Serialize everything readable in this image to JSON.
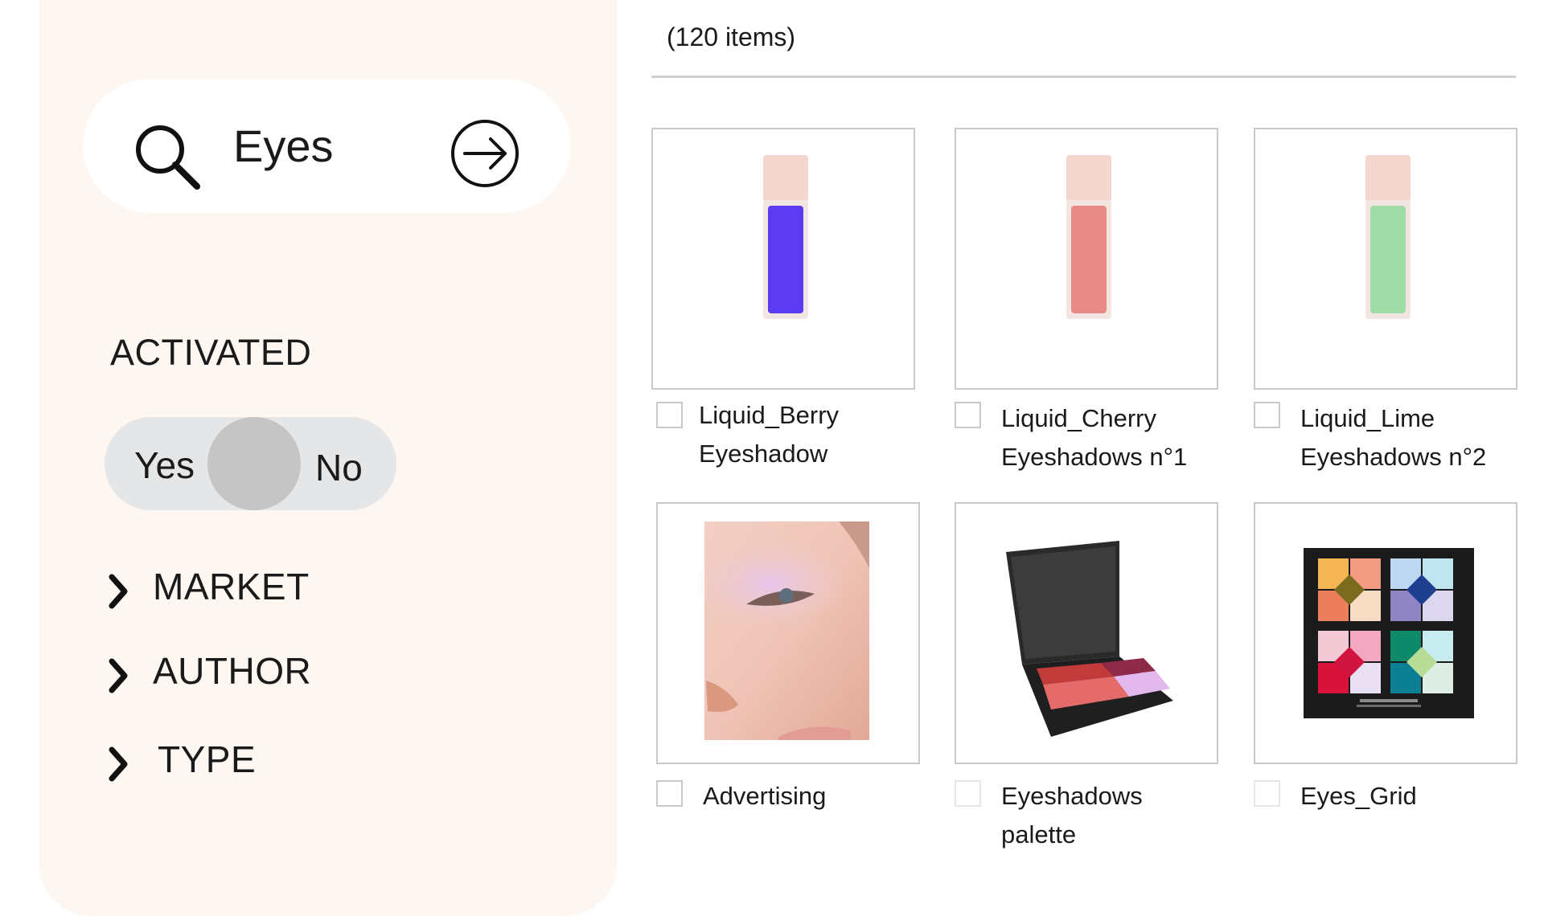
{
  "search": {
    "query": "Eyes"
  },
  "filters": {
    "activated_label": "ACTIVATED",
    "toggle": {
      "yes": "Yes",
      "no": "No"
    },
    "groups": [
      "MARKET",
      "AUTHOR",
      "TYPE"
    ]
  },
  "results": {
    "count": "(120 items)",
    "items": [
      {
        "line1": "Liquid_Berry",
        "line2": "Eyeshadow",
        "liquid_color": "#5b3cf2"
      },
      {
        "line1": "Liquid_Cherry",
        "line2": "Eyeshadows n°1",
        "liquid_color": "#e88a86"
      },
      {
        "line1": "Liquid_Lime",
        "line2": "Eyeshadows n°2",
        "liquid_color": "#9fdca8"
      },
      {
        "line1": "Advertising",
        "line2": ""
      },
      {
        "line1": "Eyeshadows",
        "line2": "palette"
      },
      {
        "line1": "Eyes_Grid",
        "line2": ""
      }
    ]
  },
  "colors": {
    "sidebar_bg": "#fdf6f1",
    "toggle_bg": "#e5e6e8",
    "knob": "#c5c5c5",
    "frame_border": "#c9c9c9"
  }
}
